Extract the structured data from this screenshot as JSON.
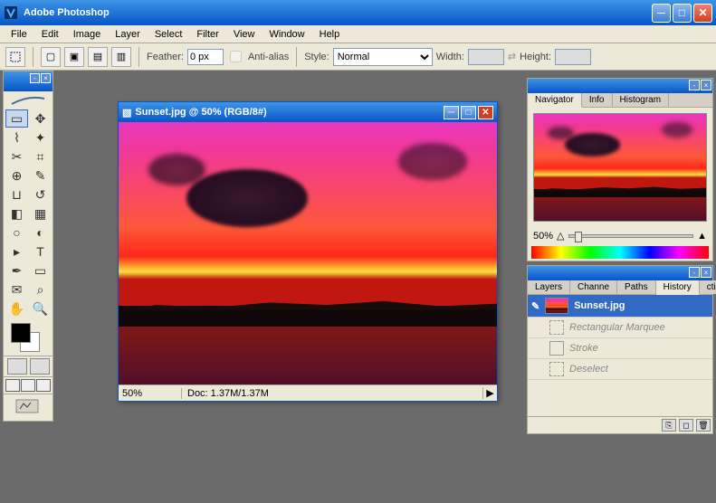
{
  "app": {
    "title": "Adobe Photoshop"
  },
  "menu": [
    "File",
    "Edit",
    "Image",
    "Layer",
    "Select",
    "Filter",
    "View",
    "Window",
    "Help"
  ],
  "options": {
    "feather_label": "Feather:",
    "feather_value": "0 px",
    "antialias_label": "Anti-alias",
    "style_label": "Style:",
    "style_value": "Normal",
    "width_label": "Width:",
    "height_label": "Height:"
  },
  "document": {
    "title": "Sunset.jpg @ 50% (RGB/8#)",
    "zoom": "50%",
    "docsize": "Doc: 1.37M/1.37M"
  },
  "navigator": {
    "tabs": [
      "Navigator",
      "Info",
      "Histogram"
    ],
    "zoom": "50%"
  },
  "history": {
    "tabs": [
      "Layers",
      "Channe",
      "Paths",
      "History",
      "ctions"
    ],
    "items": [
      {
        "label": "Sunset.jpg",
        "type": "snapshot"
      },
      {
        "label": "Rectangular Marquee",
        "type": "step"
      },
      {
        "label": "Stroke",
        "type": "step"
      },
      {
        "label": "Deselect",
        "type": "step"
      }
    ]
  },
  "toolbox": {
    "imageready": "Edit in ImageReady"
  }
}
